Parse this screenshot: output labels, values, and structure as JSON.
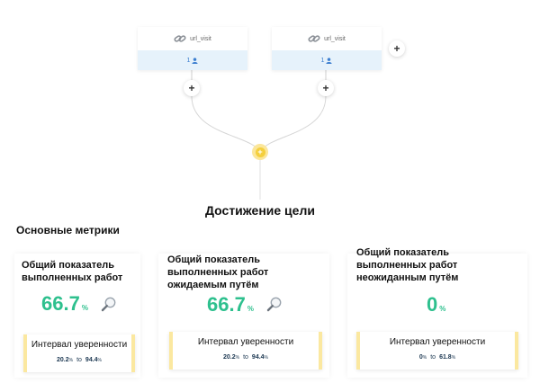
{
  "flow": {
    "nodes": [
      {
        "name": "url_visit",
        "count": "1"
      },
      {
        "name": "url_visit",
        "count": "1"
      }
    ],
    "add_symbol": "+",
    "merge_symbol": "+",
    "goal_title": "Достижение цели"
  },
  "metrics": {
    "section_title": "Основные метрики",
    "ci_label": "Интервал уверенности",
    "range_to": "to",
    "unit": "%",
    "cards": [
      {
        "title": "Общий показатель выполненных работ",
        "value": "66.7",
        "ci_low": "20.2",
        "ci_high": "94.4",
        "has_magnifier": true
      },
      {
        "title": "Общий показатель выполненных работ ожидаемым путём",
        "value": "66.7",
        "ci_low": "20.2",
        "ci_high": "94.4",
        "has_magnifier": true
      },
      {
        "title": "Общий показатель выполненных работ неожиданным путём",
        "value": "0",
        "ci_low": "0",
        "ci_high": "61.8",
        "has_magnifier": false
      }
    ]
  },
  "colors": {
    "value_green": "#2ec08e",
    "accent_yellow": "#f4cf3d",
    "ci_border": "#fbe8a0",
    "node_bottom_bg": "#e6f2fb",
    "count_blue": "#3d7fd0"
  },
  "icons": {
    "node_icon": "link-icon",
    "count_icon": "user-icon",
    "metric_icon": "magnifier-icon"
  }
}
